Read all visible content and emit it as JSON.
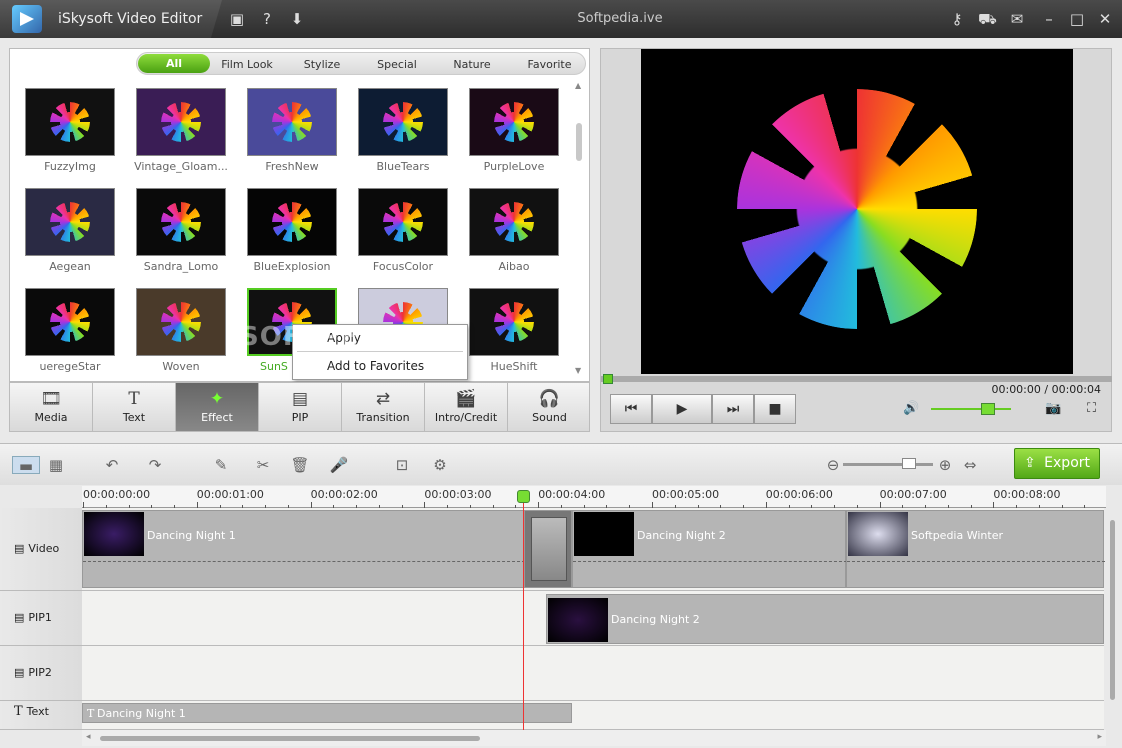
{
  "app": {
    "title": "iSkysoft Video Editor",
    "center_title": "Softpedia.ive"
  },
  "effects": {
    "tabs": [
      "All",
      "Film Look",
      "Stylize",
      "Special",
      "Nature",
      "Favorite"
    ],
    "items": [
      {
        "label": "FuzzyImg",
        "bg": "#111"
      },
      {
        "label": "Vintage_Gloam...",
        "bg": "#3a1d55"
      },
      {
        "label": "FreshNew",
        "bg": "#4a4a9a"
      },
      {
        "label": "BlueTears",
        "bg": "#0d1c33"
      },
      {
        "label": "PurpleLove",
        "bg": "#1a0a16"
      },
      {
        "label": "Aegean",
        "bg": "#2a2a44"
      },
      {
        "label": "Sandra_Lomo",
        "bg": "#0a0a0a"
      },
      {
        "label": "BlueExplosion",
        "bg": "#050505"
      },
      {
        "label": "FocusColor",
        "bg": "#0a0a0a"
      },
      {
        "label": "Aibao",
        "bg": "#111"
      },
      {
        "label": "ueregeStar",
        "bg": "#0a0a0a"
      },
      {
        "label": "Woven",
        "bg": "#4a3a2a"
      },
      {
        "label": "SunS",
        "bg": "#111"
      },
      {
        "label": "",
        "bg": "#ccccdd"
      },
      {
        "label": "HueShift",
        "bg": "#111"
      }
    ]
  },
  "context_menu": {
    "apply": "Apply",
    "add_fav": "Add to Favorites"
  },
  "watermark": "SOFTPEDIA",
  "toolbar": {
    "media": "Media",
    "text": "Text",
    "effect": "Effect",
    "pip": "PIP",
    "transition": "Transition",
    "intro": "Intro/Credit",
    "sound": "Sound"
  },
  "preview": {
    "timecode": "00:00:00 / 00:00:04"
  },
  "timeline": {
    "export": "Export",
    "ruler": [
      "00:00:00:00",
      "00:00:01:00",
      "00:00:02:00",
      "00:00:03:00",
      "00:00:04:00",
      "00:00:05:00",
      "00:00:06:00",
      "00:00:07:00",
      "00:00:08:00"
    ],
    "tracks": {
      "video": "Video",
      "pip1": "PIP1",
      "pip2": "PIP2",
      "text": "Text"
    },
    "clips": {
      "v1": "Dancing Night 1",
      "v2": "Dancing Night 2",
      "v3": "Softpedia Winter",
      "p1": "Dancing Night 2",
      "t1": "Dancing Night 1"
    }
  }
}
